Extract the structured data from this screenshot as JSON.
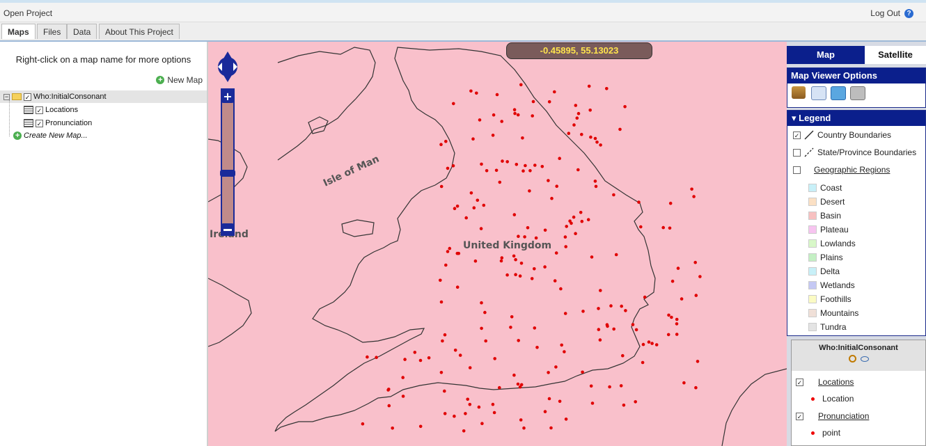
{
  "topbar": {
    "open_project": "Open Project",
    "logout": "Log Out",
    "help": "?"
  },
  "tabs": [
    "Maps",
    "Files",
    "Data",
    "About This Project"
  ],
  "left": {
    "hint": "Right-click on a map name for more options",
    "new_map": "New Map",
    "root_map": "Who:InitialConsonant",
    "layers": [
      "Locations",
      "Pronunciation"
    ],
    "create_new": "Create New Map..."
  },
  "map": {
    "coordinates": "-0.45895, 55.13023",
    "labels": {
      "isle_of_man": "Isle of Man",
      "ireland": "Ireland",
      "uk": "United Kingdom"
    },
    "point_color": "#e00000",
    "background": "#f9c0cb"
  },
  "right": {
    "tab_map": "Map",
    "tab_satellite": "Satellite",
    "options_title": "Map Viewer Options",
    "tools": [
      "ruler-icon",
      "email-icon",
      "link-icon",
      "print-icon"
    ],
    "legend_title": "Legend",
    "boundaries": [
      "Country Boundaries",
      "State/Province Boundaries",
      "Geographic Regions"
    ],
    "regions": [
      {
        "name": "Coast",
        "color": "#c8f0f8"
      },
      {
        "name": "Desert",
        "color": "#fbe0c4"
      },
      {
        "name": "Basin",
        "color": "#f7c0c0"
      },
      {
        "name": "Plateau",
        "color": "#f7c4f0"
      },
      {
        "name": "Lowlands",
        "color": "#d8f8c8"
      },
      {
        "name": "Plains",
        "color": "#c4f0c4"
      },
      {
        "name": "Delta",
        "color": "#c8f0f8"
      },
      {
        "name": "Wetlands",
        "color": "#c4c8f4"
      },
      {
        "name": "Foothills",
        "color": "#fbfbc4"
      },
      {
        "name": "Mountains",
        "color": "#f0e0d8"
      },
      {
        "name": "Tundra",
        "color": "#e4e4e4"
      }
    ],
    "layer_legend": {
      "title": "Who:InitialConsonant",
      "locations_layer": "Locations",
      "location_item": "Location",
      "pronunciation_layer": "Pronunciation",
      "point_item": "point"
    }
  }
}
